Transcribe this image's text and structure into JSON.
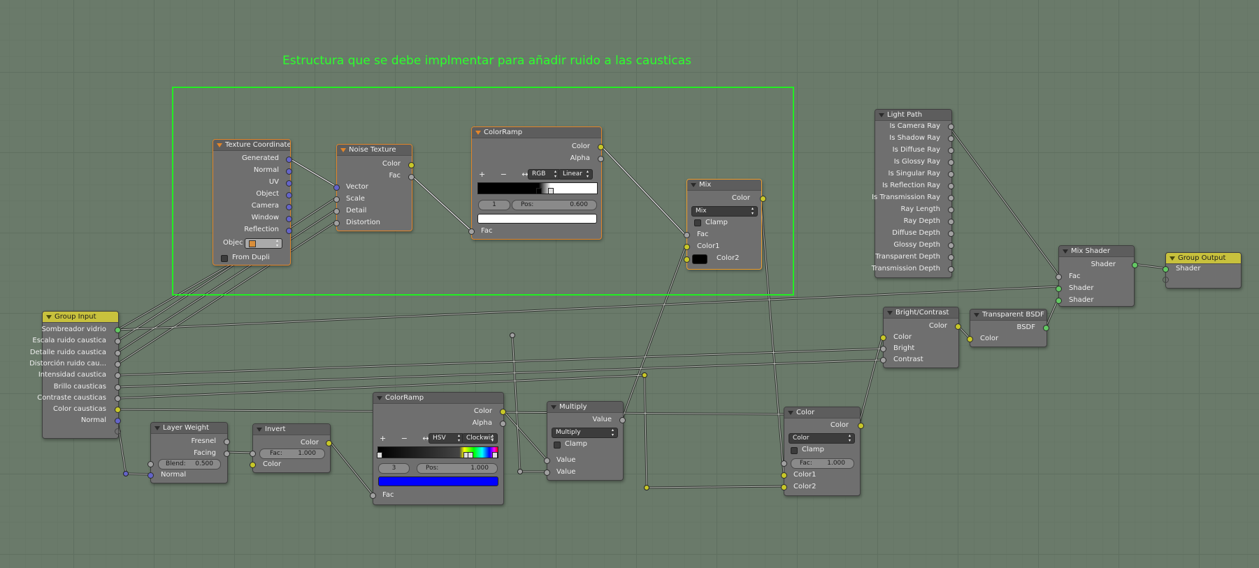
{
  "caption": "Estructura que se debe implmentar para añadir ruido a las causticas",
  "texcoord": {
    "title": "Texture Coordinate",
    "outputs": [
      "Generated",
      "Normal",
      "UV",
      "Object",
      "Camera",
      "Window",
      "Reflection"
    ],
    "object_label": "Objec",
    "from_dupli": "From Dupli"
  },
  "noise": {
    "title": "Noise Texture",
    "outputs": [
      "Color",
      "Fac"
    ],
    "inputs": [
      "Vector",
      "Scale",
      "Detail",
      "Distortion"
    ]
  },
  "ramp1": {
    "title": "ColorRamp",
    "outputs": [
      "Color",
      "Alpha"
    ],
    "mode": "RGB",
    "interp": "Linear",
    "index": "1",
    "pos_label": "Pos:",
    "pos_value": "0.600",
    "input": "Fac",
    "tools": "+ − ↔"
  },
  "mix": {
    "title": "Mix",
    "output": "Color",
    "blend": "Mix",
    "clamp": "Clamp",
    "inputs": [
      "Fac",
      "Color1",
      "Color2"
    ]
  },
  "lightpath": {
    "title": "Light Path",
    "outputs": [
      "Is Camera Ray",
      "Is Shadow Ray",
      "Is Diffuse Ray",
      "Is Glossy Ray",
      "Is Singular Ray",
      "Is Reflection Ray",
      "Is Transmission Ray",
      "Ray Length",
      "Ray Depth",
      "Diffuse Depth",
      "Glossy Depth",
      "Transparent Depth",
      "Transmission Depth"
    ]
  },
  "mixshader": {
    "title": "Mix Shader",
    "output": "Shader",
    "inputs": [
      "Fac",
      "Shader",
      "Shader"
    ]
  },
  "groupout": {
    "title": "Group Output",
    "input": "Shader"
  },
  "groupin": {
    "title": "Group Input",
    "outputs": [
      "Sombreador vidrio",
      "Escala ruido caustica",
      "Detalle ruido caustica",
      "Distorción ruido cau...",
      "Intensidad caustica",
      "Brillo causticas",
      "Contraste causticas",
      "Color causticas",
      "Normal"
    ]
  },
  "brightcontrast": {
    "title": "Bright/Contrast",
    "output": "Color",
    "inputs": [
      "Color",
      "Bright",
      "Contrast"
    ]
  },
  "transparent": {
    "title": "Transparent BSDF",
    "output": "BSDF",
    "input": "Color"
  },
  "layerweight": {
    "title": "Layer Weight",
    "outputs": [
      "Fresnel",
      "Facing"
    ],
    "blend_label": "Blend:",
    "blend_value": "0.500",
    "input": "Normal"
  },
  "invert": {
    "title": "Invert",
    "output": "Color",
    "fac_label": "Fac:",
    "fac_value": "1.000",
    "input": "Color"
  },
  "ramp2": {
    "title": "ColorRamp",
    "outputs": [
      "Color",
      "Alpha"
    ],
    "mode": "HSV",
    "interp": "Clockwis",
    "index": "3",
    "pos_label": "Pos:",
    "pos_value": "1.000",
    "input": "Fac",
    "tools": "+ − ↔"
  },
  "multiply": {
    "title": "Multiply",
    "output": "Value",
    "op": "Multiply",
    "clamp": "Clamp",
    "inputs": [
      "Value",
      "Value"
    ]
  },
  "colormix": {
    "title": "Color",
    "output": "Color",
    "blend": "Color",
    "clamp": "Clamp",
    "fac_label": "Fac:",
    "fac_value": "1.000",
    "inputs": [
      "Color1",
      "Color2"
    ]
  },
  "colors": {
    "frame": "#22ee22",
    "caption": "#2cff2c",
    "selected_border": "#e2852a",
    "vector_socket": "#6464c8",
    "color_socket": "#c7c729",
    "shader_socket": "#63c763",
    "float_socket": "#a1a1a1",
    "ramp2_swatch": "#0000ff"
  }
}
